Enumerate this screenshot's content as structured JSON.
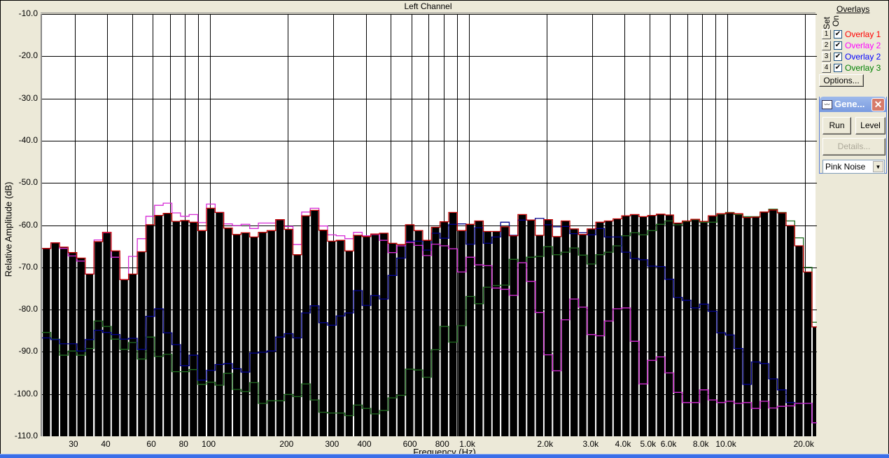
{
  "header": {
    "title": "Left Channel"
  },
  "overlays_panel": {
    "title": "Overlays",
    "col_set": "Set",
    "col_on": "On",
    "items": [
      {
        "set": "1",
        "label": "Overlay 1",
        "checked": true,
        "color": "#ff0000"
      },
      {
        "set": "2",
        "label": "Overlay 2",
        "checked": true,
        "color": "#ff00ff"
      },
      {
        "set": "3",
        "label": "Overlay 2",
        "checked": true,
        "color": "#0000ff"
      },
      {
        "set": "4",
        "label": "Overlay 3",
        "checked": true,
        "color": "#008000"
      }
    ],
    "options_label": "Options..."
  },
  "generator": {
    "title": "Gene...",
    "close_icon": "close-icon",
    "run_label": "Run",
    "level_label": "Level",
    "details_label": "Details...",
    "signal": "Pink Noise"
  },
  "chart_data": {
    "type": "bar",
    "xlabel": "Frequency (Hz)",
    "ylabel": "Relative Amplitude (dB)",
    "xscale": "log",
    "xlim": [
      22.4,
      22200
    ],
    "ylim": [
      -110,
      -10
    ],
    "grid": true,
    "yticks": [
      "-10.0",
      "-20.0",
      "-30.0",
      "-40.0",
      "-50.0",
      "-60.0",
      "-70.0",
      "-80.0",
      "-90.0",
      "-100.0",
      "-110.0"
    ],
    "xticks": [
      {
        "value": 30,
        "label": "30"
      },
      {
        "value": 40,
        "label": "40"
      },
      {
        "value": 60,
        "label": "60"
      },
      {
        "value": 80,
        "label": "80"
      },
      {
        "value": 100,
        "label": "100"
      },
      {
        "value": 200,
        "label": "200"
      },
      {
        "value": 300,
        "label": "300"
      },
      {
        "value": 400,
        "label": "400"
      },
      {
        "value": 600,
        "label": "600"
      },
      {
        "value": 800,
        "label": "800"
      },
      {
        "value": 1000,
        "label": "1.0k"
      },
      {
        "value": 2000,
        "label": "2.0k"
      },
      {
        "value": 3000,
        "label": "3.0k"
      },
      {
        "value": 4000,
        "label": "4.0k"
      },
      {
        "value": 5000,
        "label": "5.0k"
      },
      {
        "value": 6000,
        "label": "6.0k"
      },
      {
        "value": 8000,
        "label": "8.0k"
      },
      {
        "value": 10000,
        "label": "10.0k"
      },
      {
        "value": 20000,
        "label": "20.0k"
      }
    ],
    "x": [
      23.3,
      25.2,
      27.2,
      29.4,
      31.7,
      34.2,
      37.0,
      39.9,
      43.1,
      46.6,
      50.3,
      54.4,
      58.7,
      63.4,
      68.5,
      74.0,
      79.9,
      86.3,
      93.2,
      100.7,
      108.7,
      117.4,
      126.8,
      137.0,
      147.9,
      159.8,
      172.6,
      186.4,
      201.3,
      217.4,
      234.8,
      253.6,
      273.9,
      295.8,
      319.5,
      345.1,
      372.8,
      402.6,
      434.8,
      469.6,
      507.2,
      547.8,
      591.7,
      639.0,
      690.2,
      745.6,
      805.3,
      869.7,
      939.4,
      1015,
      1096,
      1184,
      1278,
      1381,
      1491,
      1611,
      1740,
      1879,
      2029,
      2192,
      2367,
      2557,
      2761,
      2982,
      3221,
      3479,
      3758,
      4058,
      4383,
      4734,
      5113,
      5523,
      5965,
      6442,
      6958,
      7515,
      8117,
      8767,
      9469,
      10227,
      11046,
      11930,
      12885,
      13916,
      15030,
      16234,
      17533,
      18937,
      20453,
      22091
    ],
    "bar_color": "#000000",
    "values": [
      -65.5,
      -64.2,
      -65.2,
      -66.5,
      -67.8,
      -71.6,
      -63.9,
      -61.7,
      -66.1,
      -72.9,
      -71.6,
      -66.3,
      -59.9,
      -57.7,
      -57.2,
      -59.1,
      -58.9,
      -59.3,
      -61.3,
      -56.0,
      -57.0,
      -60.7,
      -62.2,
      -61.8,
      -62.8,
      -61.7,
      -61.3,
      -58.7,
      -61.0,
      -67.0,
      -57.8,
      -56.5,
      -61.2,
      -63.8,
      -63.6,
      -66.1,
      -62.4,
      -62.7,
      -62.1,
      -61.9,
      -64.3,
      -64.6,
      -59.9,
      -61.3,
      -63.6,
      -60.5,
      -59.2,
      -57.0,
      -61.3,
      -59.8,
      -59.0,
      -61.5,
      -61.5,
      -60.4,
      -62.5,
      -57.5,
      -58.8,
      -62.4,
      -58.7,
      -62.7,
      -59.0,
      -60.9,
      -62.2,
      -60.9,
      -59.3,
      -59.0,
      -58.5,
      -57.8,
      -57.5,
      -58.0,
      -57.7,
      -57.4,
      -57.6,
      -59.5,
      -59.0,
      -58.6,
      -59.1,
      -57.8,
      -57.3,
      -57.1,
      -57.3,
      -58.2,
      -58.1,
      -56.9,
      -56.4,
      -57.1,
      -60.1,
      -64.9,
      -71.1,
      -84.1
    ],
    "series": [
      {
        "name": "Overlay 3",
        "color": "#1f6b1f",
        "values": [
          -85.4,
          -87.0,
          -90.8,
          -89.8,
          -90.8,
          -89.2,
          -82.7,
          -84.0,
          -87.0,
          -89.4,
          -87.8,
          -91.7,
          -86.5,
          -91.1,
          -90.6,
          -94.7,
          -94.7,
          -94.2,
          -97.7,
          -97.2,
          -97.9,
          -95.1,
          -98.9,
          -99.4,
          -97.3,
          -102.2,
          -101.6,
          -101.6,
          -100.1,
          -100.6,
          -97.6,
          -101.4,
          -104.3,
          -104.5,
          -104.5,
          -105.1,
          -102.6,
          -103.4,
          -104.7,
          -103.9,
          -100.9,
          -100.3,
          -94.1,
          -94.3,
          -96.0,
          -89.5,
          -84.0,
          -87.7,
          -83.8,
          -76.9,
          -78.6,
          -74.7,
          -74.3,
          -74.2,
          -68.1,
          -68.9,
          -67.6,
          -67.4,
          -65.1,
          -67.0,
          -66.4,
          -65.4,
          -67.1,
          -69.2,
          -67.0,
          -66.4,
          -64.9,
          -62.5,
          -61.8,
          -62.3,
          -61.3,
          -59.8,
          -59.0,
          -59.9,
          -59.1,
          -58.7,
          -59.3,
          -59.3,
          -57.4,
          -57.0,
          -57.5,
          -58.0,
          -58.0,
          -56.9,
          -56.2,
          -57.0,
          -59.0,
          -63.0,
          -70.0,
          -83.0
        ]
      },
      {
        "name": "Overlay 2",
        "color": "#00008c",
        "values": [
          -86.7,
          -87.1,
          -88.1,
          -88.1,
          -89.8,
          -87.1,
          -84.9,
          -85.4,
          -85.9,
          -87.0,
          -86.8,
          -89.4,
          -81.6,
          -79.8,
          -85.5,
          -88.3,
          -93.3,
          -90.8,
          -96.7,
          -94.4,
          -93.0,
          -92.8,
          -94.0,
          -94.8,
          -90.3,
          -90.1,
          -89.8,
          -86.5,
          -85.7,
          -86.7,
          -80.8,
          -79.1,
          -83.1,
          -83.7,
          -81.5,
          -80.8,
          -75.5,
          -79.0,
          -76.7,
          -77.5,
          -71.9,
          -67.8,
          -63.8,
          -63.8,
          -65.9,
          -61.9,
          -63.1,
          -59.8,
          -59.7,
          -64.5,
          -60.6,
          -64.3,
          -62.8,
          -59.3,
          -62.4,
          -58.8,
          -58.8,
          -58.4,
          -59.9,
          -60.4,
          -60.3,
          -62.0,
          -61.8,
          -62.3,
          -60.8,
          -62.8,
          -62.8,
          -66.4,
          -67.9,
          -68.2,
          -69.7,
          -69.8,
          -72.8,
          -77.1,
          -77.8,
          -79.6,
          -78.7,
          -80.4,
          -85.5,
          -86.0,
          -89.2,
          -97.7,
          -92.4,
          -92.8,
          -96.4,
          -99.0,
          -102.0,
          -102.2,
          -102.2,
          -106.8
        ]
      },
      {
        "name": "Overlay 2",
        "color": "#d62ad6",
        "values": [
          -65.5,
          -64.2,
          -65.5,
          -67.3,
          -68.5,
          -71.6,
          -63.5,
          -61.8,
          -67.6,
          -72.9,
          -67.4,
          -63.2,
          -57.9,
          -55.3,
          -54.8,
          -57.1,
          -57.9,
          -57.5,
          -59.4,
          -55.0,
          -57.0,
          -59.7,
          -60.1,
          -59.8,
          -60.8,
          -59.5,
          -59.5,
          -58.7,
          -60.3,
          -64.6,
          -56.9,
          -56.0,
          -60.2,
          -62.3,
          -62.5,
          -63.2,
          -61.7,
          -62.5,
          -62.2,
          -63.6,
          -66.5,
          -64.9,
          -64.1,
          -64.8,
          -67.2,
          -64.5,
          -64.9,
          -65.6,
          -71.1,
          -67.6,
          -69.4,
          -69.6,
          -74.9,
          -75.2,
          -76.6,
          -68.9,
          -73.3,
          -80.7,
          -90.7,
          -94.5,
          -82.4,
          -77.5,
          -79.4,
          -85.9,
          -86.2,
          -82.7,
          -79.8,
          -79.6,
          -87.5,
          -97.6,
          -92.0,
          -91.2,
          -95.0,
          -99.6,
          -102.0,
          -102.0,
          -99.0,
          -101.4,
          -102.0,
          -101.7,
          -102.2,
          -102.0,
          -103.4,
          -101.7,
          -103.3,
          -102.9,
          -102.8,
          -102.2,
          -102.2,
          -106.8
        ]
      },
      {
        "name": "Overlay 1",
        "color": "#c00000",
        "values": [
          -65.5,
          -64.2,
          -65.2,
          -66.5,
          -67.8,
          -71.6,
          -63.9,
          -61.7,
          -66.1,
          -72.9,
          -71.6,
          -66.3,
          -59.9,
          -57.7,
          -57.2,
          -59.1,
          -58.9,
          -59.3,
          -61.3,
          -56.0,
          -57.0,
          -60.7,
          -62.2,
          -61.8,
          -62.8,
          -61.7,
          -61.3,
          -58.7,
          -61.0,
          -67.0,
          -57.8,
          -56.5,
          -61.2,
          -63.8,
          -63.6,
          -66.1,
          -62.4,
          -62.7,
          -62.1,
          -61.9,
          -64.3,
          -64.6,
          -59.9,
          -61.3,
          -63.6,
          -60.5,
          -59.2,
          -57.0,
          -61.3,
          -59.8,
          -59.0,
          -61.5,
          -61.5,
          -60.4,
          -62.5,
          -57.5,
          -58.8,
          -62.4,
          -58.7,
          -62.7,
          -59.0,
          -60.9,
          -62.2,
          -60.9,
          -59.3,
          -59.0,
          -58.5,
          -57.8,
          -57.5,
          -58.0,
          -57.7,
          -57.4,
          -57.6,
          -59.5,
          -59.0,
          -58.6,
          -59.1,
          -57.8,
          -57.3,
          -57.1,
          -57.3,
          -58.2,
          -58.1,
          -56.9,
          -56.4,
          -57.1,
          -60.1,
          -64.9,
          -71.1,
          -84.1
        ]
      }
    ]
  }
}
